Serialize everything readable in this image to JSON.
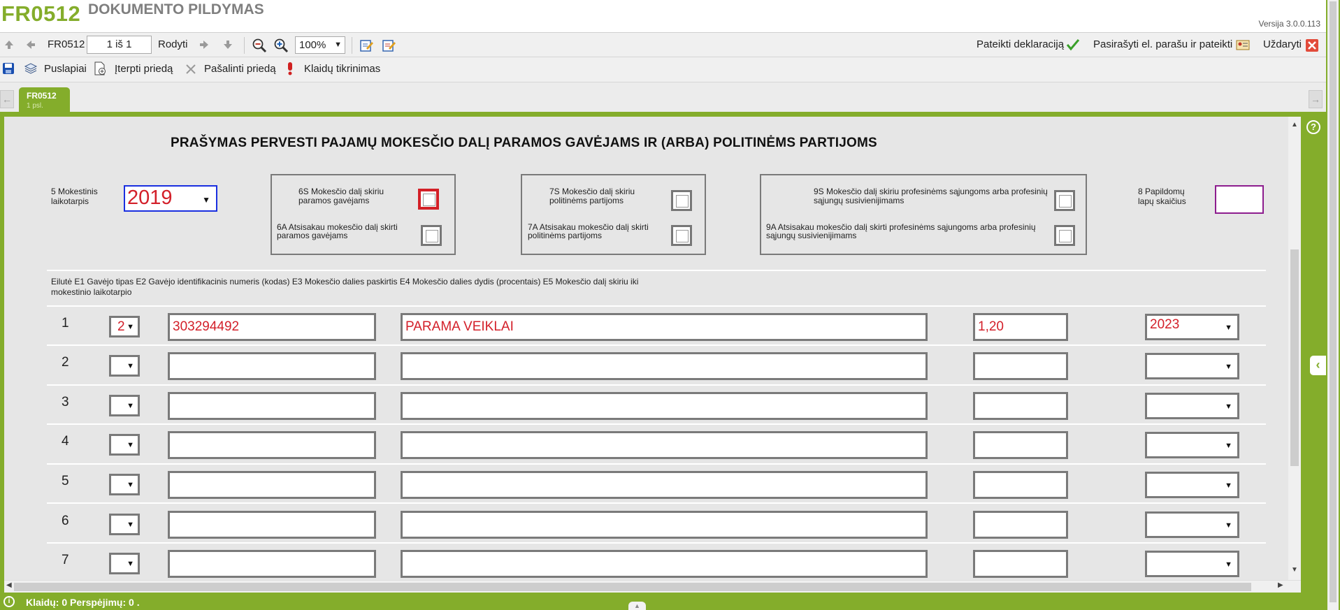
{
  "header": {
    "form_code": "FR0512",
    "form_title": "DOKUMENTO PILDYMAS",
    "version": "Versija 3.0.0.113"
  },
  "toolbar": {
    "form_label": "FR0512",
    "page_value": "1 iš 1",
    "show_label": "Rodyti",
    "zoom_value": "100%",
    "submit_label": "Pateikti deklaraciją",
    "sign_submit_label": "Pasirašyti el. parašu ir pateikti",
    "close_label": "Uždaryti"
  },
  "toolbar2": {
    "pages_label": "Puslapiai",
    "insert_label": "Įterpti priedą",
    "remove_label": "Pašalinti priedą",
    "errors_check_label": "Klaidų tikrinimas"
  },
  "tab": {
    "name": "FR0512",
    "sub": "1 psl."
  },
  "form": {
    "title": "PRAŠYMAS PERVESTI PAJAMŲ MOKESČIO DALĮ PARAMOS GAVĖJAMS IR (ARBA) POLITINĖMS PARTIJOMS",
    "period_label_1": "5 Mokestinis",
    "period_label_2": "laikotarpis",
    "period_value": "2019",
    "g6s_1": "6S Mokesčio dalį skiriu",
    "g6s_2": "paramos gavėjams",
    "g6a_1": "6A Atsisakau mokesčio dalį skirti",
    "g6a_2": "paramos gavėjams",
    "g7s_1": "7S Mokesčio dalį skiriu",
    "g7s_2": "politinėms partijoms",
    "g7a_1": "7A Atsisakau mokesčio dalį skirti",
    "g7a_2": "politinėms partijoms",
    "g9s_1": "9S Mokesčio dalį skiriu profesinėms sąjungoms arba profesinių",
    "g9s_2": "sąjungų susivienijimams",
    "g9a_1": "9A Atsisakau mokesčio dalį skirti profesinėms sąjungoms arba profesinių",
    "g9a_2": "sąjungų susivienijimams",
    "pages_label_1": "8 Papildomų",
    "pages_label_2": "lapų skaičius",
    "col_header_1": "Eilutė E1 Gavėjo tipas E2 Gavėjo identifikacinis numeris (kodas) E3 Mokesčio dalies paskirtis E4 Mokesčio dalies dydis (procentais) E5 Mokesčio dalį skiriu iki",
    "col_header_2": "mokestinio laikotarpio",
    "rows": [
      {
        "num": "1",
        "type": "2",
        "code": "303294492",
        "purpose": "PARAMA VEIKLAI",
        "percent": "1,20",
        "until": "2023"
      },
      {
        "num": "2",
        "type": "",
        "code": "",
        "purpose": "",
        "percent": "",
        "until": ""
      },
      {
        "num": "3",
        "type": "",
        "code": "",
        "purpose": "",
        "percent": "",
        "until": ""
      },
      {
        "num": "4",
        "type": "",
        "code": "",
        "purpose": "",
        "percent": "",
        "until": ""
      },
      {
        "num": "5",
        "type": "",
        "code": "",
        "purpose": "",
        "percent": "",
        "until": ""
      },
      {
        "num": "6",
        "type": "",
        "code": "",
        "purpose": "",
        "percent": "",
        "until": ""
      },
      {
        "num": "7",
        "type": "",
        "code": "",
        "purpose": "",
        "percent": "",
        "until": ""
      }
    ]
  },
  "status": {
    "text": "Klaidų: 0 Perspėjimų: 0 ."
  },
  "colors": {
    "brand": "#84ad2b",
    "value_text": "#d3202a",
    "year_border": "#1a2fe0",
    "pages_border": "#8d1d8e"
  },
  "icons": [
    "arrow-up-icon",
    "arrow-left-icon",
    "arrow-right-icon",
    "arrow-down-icon",
    "zoom-out-icon",
    "zoom-in-icon",
    "edit-form-icon",
    "edit-checklist-icon",
    "checkmark-icon",
    "signature-card-icon",
    "close-x-icon",
    "save-disk-icon",
    "pages-stack-icon",
    "insert-attachment-icon",
    "remove-x-icon",
    "exclamation-icon",
    "help-icon",
    "chevron-left-icon",
    "info-circle-icon"
  ]
}
